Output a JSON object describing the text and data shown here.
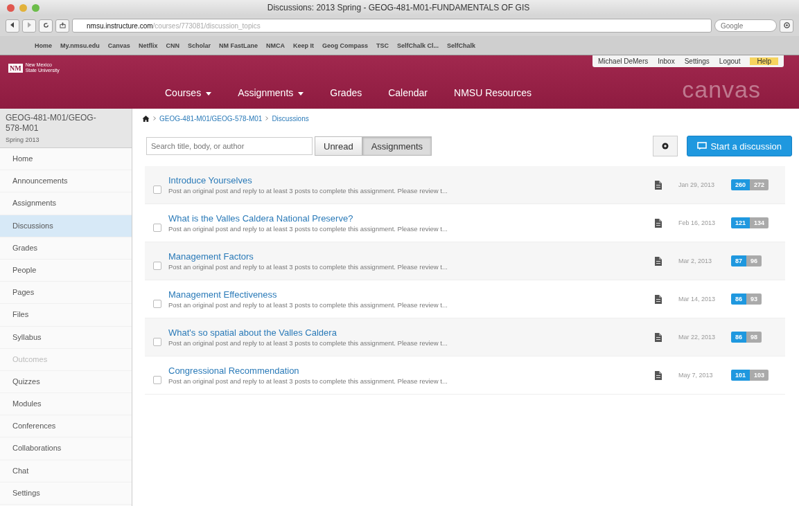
{
  "window": {
    "title": "Discussions: 2013 Spring - GEOG-481-M01-FUNDAMENTALS OF GIS"
  },
  "browser": {
    "url_host": "nmsu.instructure.com",
    "url_path": "/courses/773081/discussion_topics",
    "search_placeholder": "Google",
    "bookmarks": [
      "Home",
      "My.nmsu.edu",
      "Canvas",
      "Netflix",
      "CNN",
      "Scholar",
      "NM FastLane",
      "NMCA",
      "Keep It",
      "Geog Compass",
      "TSC",
      "SelfChalk Cl...",
      "SelfChalk"
    ]
  },
  "user_menu": [
    "Michael DeMers",
    "Inbox",
    "Settings",
    "Logout",
    "Help"
  ],
  "logo": {
    "line1": "New Mexico",
    "line2": "State University",
    "mark": "NM"
  },
  "nav": [
    {
      "label": "Courses",
      "dropdown": true
    },
    {
      "label": "Assignments",
      "dropdown": true
    },
    {
      "label": "Grades",
      "dropdown": false
    },
    {
      "label": "Calendar",
      "dropdown": false
    },
    {
      "label": "NMSU Resources",
      "dropdown": false
    }
  ],
  "brand": "canvas",
  "sidebar": {
    "course": "GEOG-481-M01/GEOG-578-M01",
    "term": "Spring 2013",
    "items": [
      {
        "label": "Home",
        "selected": false,
        "disabled": false
      },
      {
        "label": "Announcements",
        "selected": false,
        "disabled": false
      },
      {
        "label": "Assignments",
        "selected": false,
        "disabled": false
      },
      {
        "label": "Discussions",
        "selected": true,
        "disabled": false
      },
      {
        "label": "Grades",
        "selected": false,
        "disabled": false
      },
      {
        "label": "People",
        "selected": false,
        "disabled": false
      },
      {
        "label": "Pages",
        "selected": false,
        "disabled": false
      },
      {
        "label": "Files",
        "selected": false,
        "disabled": false
      },
      {
        "label": "Syllabus",
        "selected": false,
        "disabled": false
      },
      {
        "label": "Outcomes",
        "selected": false,
        "disabled": true
      },
      {
        "label": "Quizzes",
        "selected": false,
        "disabled": false
      },
      {
        "label": "Modules",
        "selected": false,
        "disabled": false
      },
      {
        "label": "Conferences",
        "selected": false,
        "disabled": false
      },
      {
        "label": "Collaborations",
        "selected": false,
        "disabled": false
      },
      {
        "label": "Chat",
        "selected": false,
        "disabled": false
      },
      {
        "label": "Settings",
        "selected": false,
        "disabled": false
      }
    ]
  },
  "breadcrumb": [
    "GEOG-481-M01/GEOG-578-M01",
    "Discussions"
  ],
  "toolbar": {
    "search_placeholder": "Search title, body, or author",
    "filters": [
      {
        "label": "Unread",
        "selected": false
      },
      {
        "label": "Assignments",
        "selected": true
      }
    ],
    "start_button": "Start a discussion"
  },
  "discussions": [
    {
      "title": "Introduce Yourselves",
      "summary": "Post an original post and reply to at least 3 posts to complete this assignment.  Please review t...",
      "date": "Jan 29, 2013",
      "unread": "260",
      "total": "272",
      "checked": false
    },
    {
      "title": "What is the Valles Caldera National Preserve?",
      "summary": "Post an original post and reply to at least 3 posts to complete this assignment.  Please review t...",
      "date": "Feb 16, 2013",
      "unread": "121",
      "total": "134",
      "checked": false
    },
    {
      "title": "Management Factors",
      "summary": "Post an original post and reply to at least 3 posts to complete this assignment.  Please review t...",
      "date": "Mar 2, 2013",
      "unread": "87",
      "total": "96",
      "checked": false
    },
    {
      "title": "Management Effectiveness",
      "summary": "Post an original post and reply to at least 3 posts to complete this assignment.  Please review t...",
      "date": "Mar 14, 2013",
      "unread": "86",
      "total": "93",
      "checked": false
    },
    {
      "title": "What's so spatial about the Valles Caldera",
      "summary": "Post an original post and reply to at least 3 posts to complete this assignment.  Please review t...",
      "date": "Mar 22, 2013",
      "unread": "86",
      "total": "98",
      "checked": false
    },
    {
      "title": "Congressional Recommendation",
      "summary": "Post an original post and reply to at least 3 posts to complete this assignment.  Please review t...",
      "date": "May 7, 2013",
      "unread": "101",
      "total": "103",
      "checked": false
    }
  ]
}
